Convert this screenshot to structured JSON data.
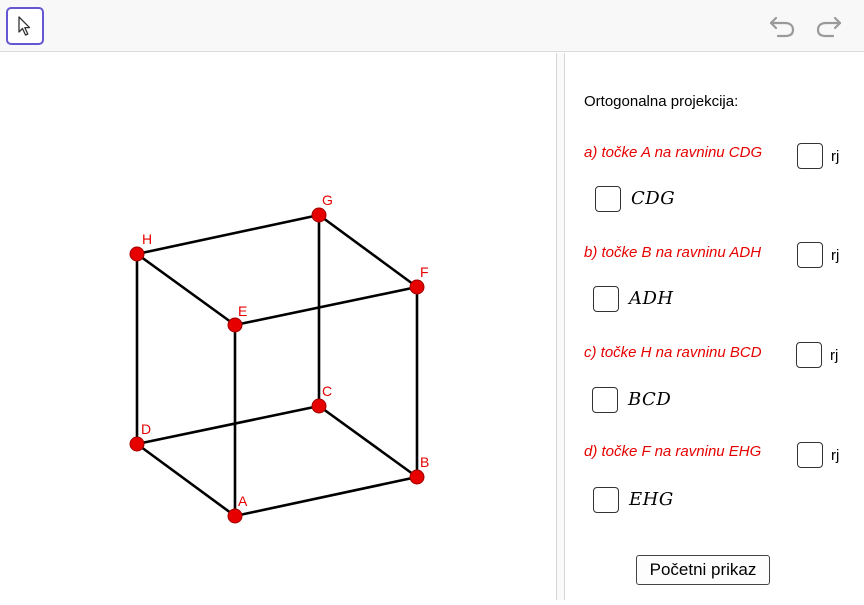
{
  "toolbar": {
    "tools": [
      {
        "name": "move",
        "icon": "arrow-cursor-icon"
      }
    ],
    "undo_icon": "undo-icon",
    "redo_icon": "redo-icon"
  },
  "colors": {
    "point": "#e60000",
    "edge": "#000000",
    "task_text": "#e60000",
    "tool_highlight": "#6557d2"
  },
  "cube": {
    "points": [
      {
        "id": "A",
        "label": "A"
      },
      {
        "id": "B",
        "label": "B"
      },
      {
        "id": "C",
        "label": "C"
      },
      {
        "id": "D",
        "label": "D"
      },
      {
        "id": "E",
        "label": "E"
      },
      {
        "id": "F",
        "label": "F"
      },
      {
        "id": "G",
        "label": "G"
      },
      {
        "id": "H",
        "label": "H"
      }
    ],
    "edges": [
      [
        "A",
        "B"
      ],
      [
        "B",
        "C"
      ],
      [
        "C",
        "D"
      ],
      [
        "D",
        "A"
      ],
      [
        "E",
        "F"
      ],
      [
        "F",
        "G"
      ],
      [
        "G",
        "H"
      ],
      [
        "H",
        "E"
      ],
      [
        "A",
        "E"
      ],
      [
        "B",
        "F"
      ],
      [
        "C",
        "G"
      ],
      [
        "D",
        "H"
      ]
    ]
  },
  "panel": {
    "heading": "Ortogonalna projekcija:",
    "tasks": [
      {
        "text": "a) točke A na ravninu CDG",
        "answer_label": "rj",
        "plane": "CDG",
        "answer_checked": false,
        "plane_checked": false
      },
      {
        "text": "b) točke B na ravninu ADH",
        "answer_label": "rj",
        "plane": "ADH",
        "answer_checked": false,
        "plane_checked": false
      },
      {
        "text": "c) točke H na ravninu BCD",
        "answer_label": "rj",
        "plane": "BCD",
        "answer_checked": false,
        "plane_checked": false
      },
      {
        "text": "d) točke F na ravninu EHG",
        "answer_label": "rj",
        "plane": "EHG",
        "answer_checked": false,
        "plane_checked": false
      }
    ],
    "reset_button": "Početni prikaz"
  }
}
